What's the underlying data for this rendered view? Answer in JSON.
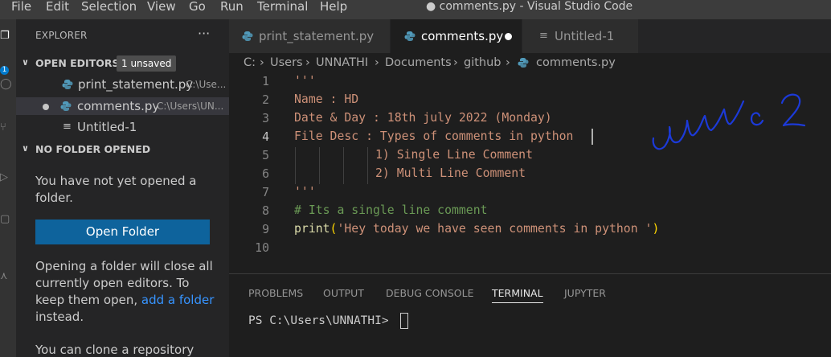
{
  "menubar": {
    "items": [
      "File",
      "Edit",
      "Selection",
      "View",
      "Go",
      "Run",
      "Terminal",
      "Help"
    ],
    "window_title": "● comments.py - Visual Studio Code"
  },
  "activitybar": {
    "badge": "1"
  },
  "sidebar": {
    "title": "EXPLORER",
    "more": "···",
    "open_editors": {
      "header": "OPEN EDITORS",
      "badge": "1 unsaved",
      "items": [
        {
          "name": "print_statement.py",
          "path": "C:\\Use...",
          "icon": "python-icon",
          "dirty": false
        },
        {
          "name": "comments.py",
          "path": "C:\\Users\\UN...",
          "icon": "python-icon",
          "dirty": true
        },
        {
          "name": "Untitled-1",
          "path": "",
          "icon": "text-file-icon",
          "dirty": false
        }
      ]
    },
    "no_folder": {
      "header": "NO FOLDER OPENED",
      "message": "You have not yet opened a folder.",
      "button": "Open Folder",
      "note_before": "Opening a folder will close all currently open editors. To keep them open, ",
      "note_link": "add a folder",
      "note_after": " instead.",
      "clone_text": "You can clone a repository"
    }
  },
  "tabs": [
    {
      "label": "print_statement.py",
      "icon": "python-icon",
      "active": false
    },
    {
      "label": "comments.py",
      "icon": "python-icon",
      "active": true,
      "dirty": true
    },
    {
      "label": "Untitled-1",
      "icon": "text-file-icon",
      "active": false
    }
  ],
  "breadcrumb": [
    "C:",
    "Users",
    "UNNATHI",
    "Documents",
    "github",
    "comments.py"
  ],
  "editor": {
    "current_line": 4,
    "lines": [
      {
        "n": "1",
        "text": "'''"
      },
      {
        "n": "2",
        "text": "Name : HD"
      },
      {
        "n": "3",
        "text": "Date & Day : 18th july 2022 (Monday)"
      },
      {
        "n": "4",
        "text": "File Desc : Types of comments in python "
      },
      {
        "n": "5",
        "text": "1) Single Line Comment"
      },
      {
        "n": "6",
        "text": "2) Multi Line Comment"
      },
      {
        "n": "7",
        "text": "'''"
      },
      {
        "n": "8",
        "text": "# Its a single line comment"
      },
      {
        "n": "9",
        "fn": "print",
        "open": "(",
        "str": "'Hey today we have seen comments in python '",
        "close": ")"
      },
      {
        "n": "10",
        "text": ""
      }
    ],
    "annotation": "unnati 2"
  },
  "panel": {
    "tabs": [
      "PROBLEMS",
      "OUTPUT",
      "DEBUG CONSOLE",
      "TERMINAL",
      "JUPYTER"
    ],
    "active_tab": "TERMINAL",
    "terminal_prompt": "PS C:\\Users\\UNNATHI> "
  },
  "colors": {
    "accent": "#007acc",
    "button": "#0e639c",
    "string": "#ce9178",
    "comment": "#6a9955",
    "function": "#dcdcaa",
    "python_icon": "#519aba"
  }
}
